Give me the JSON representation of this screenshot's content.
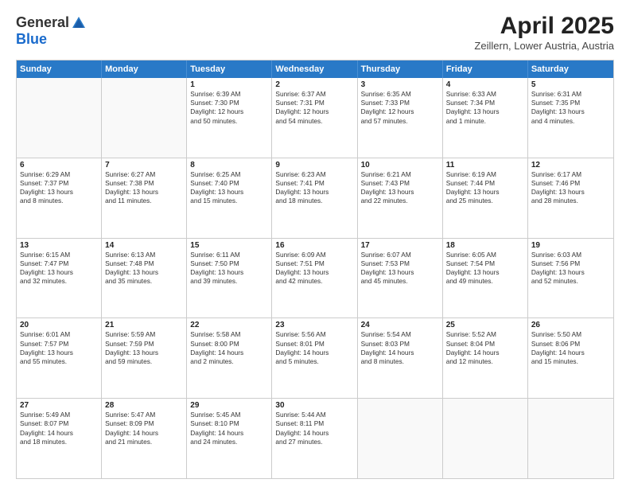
{
  "header": {
    "logo_general": "General",
    "logo_blue": "Blue",
    "title": "April 2025",
    "location": "Zeillern, Lower Austria, Austria"
  },
  "weekdays": [
    "Sunday",
    "Monday",
    "Tuesday",
    "Wednesday",
    "Thursday",
    "Friday",
    "Saturday"
  ],
  "weeks": [
    [
      {
        "day": "",
        "empty": true
      },
      {
        "day": "",
        "empty": true
      },
      {
        "day": "1",
        "lines": [
          "Sunrise: 6:39 AM",
          "Sunset: 7:30 PM",
          "Daylight: 12 hours",
          "and 50 minutes."
        ]
      },
      {
        "day": "2",
        "lines": [
          "Sunrise: 6:37 AM",
          "Sunset: 7:31 PM",
          "Daylight: 12 hours",
          "and 54 minutes."
        ]
      },
      {
        "day": "3",
        "lines": [
          "Sunrise: 6:35 AM",
          "Sunset: 7:33 PM",
          "Daylight: 12 hours",
          "and 57 minutes."
        ]
      },
      {
        "day": "4",
        "lines": [
          "Sunrise: 6:33 AM",
          "Sunset: 7:34 PM",
          "Daylight: 13 hours",
          "and 1 minute."
        ]
      },
      {
        "day": "5",
        "lines": [
          "Sunrise: 6:31 AM",
          "Sunset: 7:35 PM",
          "Daylight: 13 hours",
          "and 4 minutes."
        ]
      }
    ],
    [
      {
        "day": "6",
        "lines": [
          "Sunrise: 6:29 AM",
          "Sunset: 7:37 PM",
          "Daylight: 13 hours",
          "and 8 minutes."
        ]
      },
      {
        "day": "7",
        "lines": [
          "Sunrise: 6:27 AM",
          "Sunset: 7:38 PM",
          "Daylight: 13 hours",
          "and 11 minutes."
        ]
      },
      {
        "day": "8",
        "lines": [
          "Sunrise: 6:25 AM",
          "Sunset: 7:40 PM",
          "Daylight: 13 hours",
          "and 15 minutes."
        ]
      },
      {
        "day": "9",
        "lines": [
          "Sunrise: 6:23 AM",
          "Sunset: 7:41 PM",
          "Daylight: 13 hours",
          "and 18 minutes."
        ]
      },
      {
        "day": "10",
        "lines": [
          "Sunrise: 6:21 AM",
          "Sunset: 7:43 PM",
          "Daylight: 13 hours",
          "and 22 minutes."
        ]
      },
      {
        "day": "11",
        "lines": [
          "Sunrise: 6:19 AM",
          "Sunset: 7:44 PM",
          "Daylight: 13 hours",
          "and 25 minutes."
        ]
      },
      {
        "day": "12",
        "lines": [
          "Sunrise: 6:17 AM",
          "Sunset: 7:46 PM",
          "Daylight: 13 hours",
          "and 28 minutes."
        ]
      }
    ],
    [
      {
        "day": "13",
        "lines": [
          "Sunrise: 6:15 AM",
          "Sunset: 7:47 PM",
          "Daylight: 13 hours",
          "and 32 minutes."
        ]
      },
      {
        "day": "14",
        "lines": [
          "Sunrise: 6:13 AM",
          "Sunset: 7:48 PM",
          "Daylight: 13 hours",
          "and 35 minutes."
        ]
      },
      {
        "day": "15",
        "lines": [
          "Sunrise: 6:11 AM",
          "Sunset: 7:50 PM",
          "Daylight: 13 hours",
          "and 39 minutes."
        ]
      },
      {
        "day": "16",
        "lines": [
          "Sunrise: 6:09 AM",
          "Sunset: 7:51 PM",
          "Daylight: 13 hours",
          "and 42 minutes."
        ]
      },
      {
        "day": "17",
        "lines": [
          "Sunrise: 6:07 AM",
          "Sunset: 7:53 PM",
          "Daylight: 13 hours",
          "and 45 minutes."
        ]
      },
      {
        "day": "18",
        "lines": [
          "Sunrise: 6:05 AM",
          "Sunset: 7:54 PM",
          "Daylight: 13 hours",
          "and 49 minutes."
        ]
      },
      {
        "day": "19",
        "lines": [
          "Sunrise: 6:03 AM",
          "Sunset: 7:56 PM",
          "Daylight: 13 hours",
          "and 52 minutes."
        ]
      }
    ],
    [
      {
        "day": "20",
        "lines": [
          "Sunrise: 6:01 AM",
          "Sunset: 7:57 PM",
          "Daylight: 13 hours",
          "and 55 minutes."
        ]
      },
      {
        "day": "21",
        "lines": [
          "Sunrise: 5:59 AM",
          "Sunset: 7:59 PM",
          "Daylight: 13 hours",
          "and 59 minutes."
        ]
      },
      {
        "day": "22",
        "lines": [
          "Sunrise: 5:58 AM",
          "Sunset: 8:00 PM",
          "Daylight: 14 hours",
          "and 2 minutes."
        ]
      },
      {
        "day": "23",
        "lines": [
          "Sunrise: 5:56 AM",
          "Sunset: 8:01 PM",
          "Daylight: 14 hours",
          "and 5 minutes."
        ]
      },
      {
        "day": "24",
        "lines": [
          "Sunrise: 5:54 AM",
          "Sunset: 8:03 PM",
          "Daylight: 14 hours",
          "and 8 minutes."
        ]
      },
      {
        "day": "25",
        "lines": [
          "Sunrise: 5:52 AM",
          "Sunset: 8:04 PM",
          "Daylight: 14 hours",
          "and 12 minutes."
        ]
      },
      {
        "day": "26",
        "lines": [
          "Sunrise: 5:50 AM",
          "Sunset: 8:06 PM",
          "Daylight: 14 hours",
          "and 15 minutes."
        ]
      }
    ],
    [
      {
        "day": "27",
        "lines": [
          "Sunrise: 5:49 AM",
          "Sunset: 8:07 PM",
          "Daylight: 14 hours",
          "and 18 minutes."
        ]
      },
      {
        "day": "28",
        "lines": [
          "Sunrise: 5:47 AM",
          "Sunset: 8:09 PM",
          "Daylight: 14 hours",
          "and 21 minutes."
        ]
      },
      {
        "day": "29",
        "lines": [
          "Sunrise: 5:45 AM",
          "Sunset: 8:10 PM",
          "Daylight: 14 hours",
          "and 24 minutes."
        ]
      },
      {
        "day": "30",
        "lines": [
          "Sunrise: 5:44 AM",
          "Sunset: 8:11 PM",
          "Daylight: 14 hours",
          "and 27 minutes."
        ]
      },
      {
        "day": "",
        "empty": true
      },
      {
        "day": "",
        "empty": true
      },
      {
        "day": "",
        "empty": true
      }
    ]
  ]
}
